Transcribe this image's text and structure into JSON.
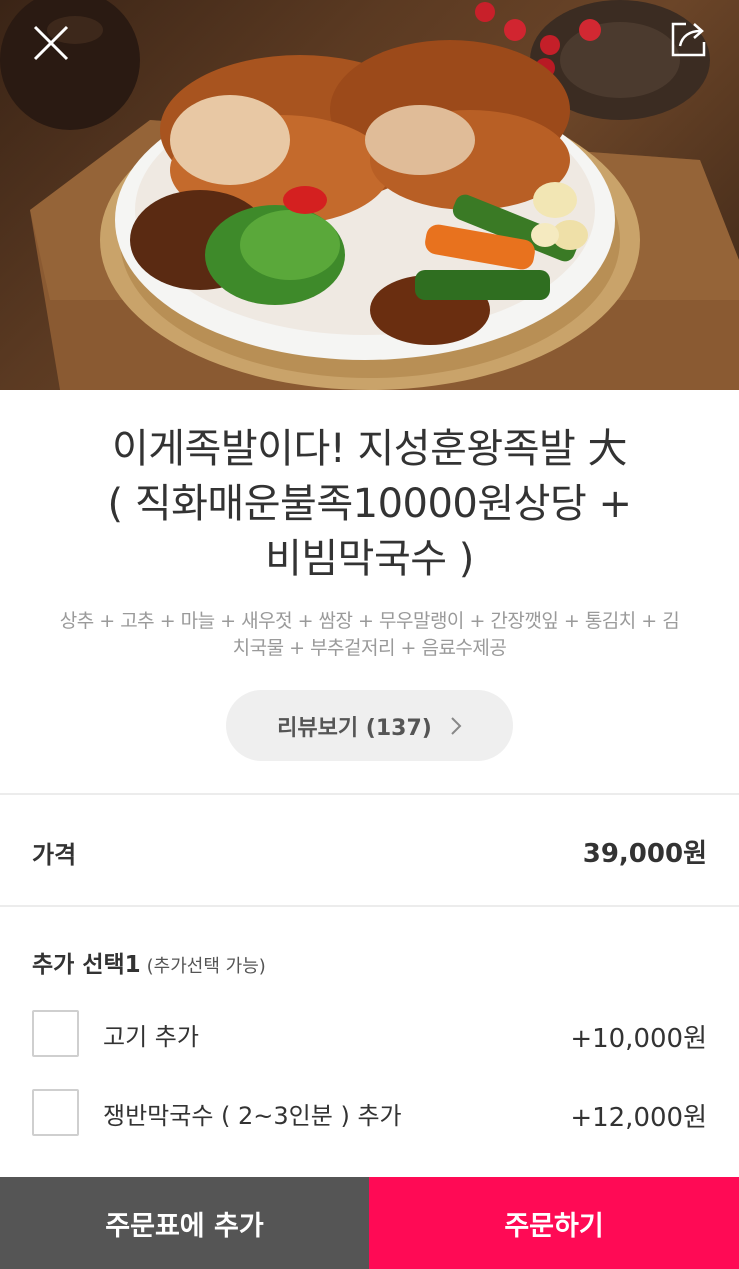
{
  "hero": {
    "image_alt": "족발 한 접시",
    "close_icon": "close-icon",
    "share_icon": "share-icon"
  },
  "product": {
    "title_line1": "이게족발이다! 지성훈왕족발 大",
    "title_line2": "( 직화매운불족10000원상당 +",
    "title_line3": "비빔막국수 )",
    "description_line1": "상추 + 고추 + 마늘 + 새우젓 + 쌈장 + 무우말랭이 + 간장깻잎 + 통김치 + 김",
    "description_line2": "치국물 + 부추겉저리 + 음료수제공"
  },
  "review": {
    "label": "리뷰보기 (137)",
    "icon": "chevron-right-icon"
  },
  "price": {
    "label": "가격",
    "value": "39,000원"
  },
  "options": {
    "section_title": "추가 선택1",
    "section_sub": "(추가선택 가능)",
    "items": [
      {
        "label": "고기 추가",
        "price": "+10,000원",
        "checked": false
      },
      {
        "label": "쟁반막국수 ( 2~3인분 ) 추가",
        "price": "+12,000원",
        "checked": false
      }
    ]
  },
  "bottom": {
    "cart_label": "주문표에 추가",
    "order_label": "주문하기"
  },
  "colors": {
    "order_accent": "#ff0a55",
    "cart_bg": "#555555"
  }
}
